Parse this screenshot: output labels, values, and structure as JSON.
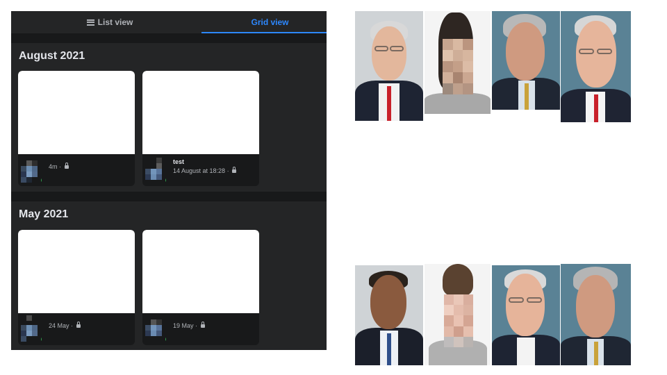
{
  "tabs": {
    "list_label": "List view",
    "grid_label": "Grid view",
    "active": "Grid view"
  },
  "sections": [
    {
      "title": "August 2021",
      "posts": [
        {
          "title": "",
          "time": "4m · "
        },
        {
          "title": "test",
          "time": "14 August at 18:28 · "
        }
      ]
    },
    {
      "title": "May 2021",
      "posts": [
        {
          "title": "",
          "time": "24 May · "
        },
        {
          "title": "",
          "time": "19 May · "
        }
      ]
    }
  ],
  "colors": {
    "accent": "#2d88ff",
    "panel_bg": "#18191a",
    "card_bg": "#242526",
    "online": "#31a24c"
  },
  "collage": {
    "columns": [
      {
        "top": "portrait-red-tie-glasses",
        "bottom": "portrait-dark-suit-blue-tie"
      },
      {
        "top": "portrait-pixelated-face",
        "bottom": "portrait-pixelated-face"
      },
      {
        "top": "portrait-gold-tie",
        "bottom": "portrait-glasses-white-background"
      },
      {
        "top": "portrait-red-tie-glasses",
        "bottom": "portrait-gold-tie"
      }
    ]
  }
}
